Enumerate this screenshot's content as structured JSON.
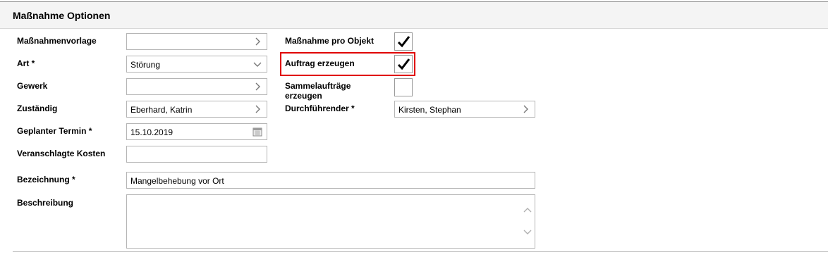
{
  "section": {
    "title": "Maßnahme Optionen"
  },
  "left_fields": {
    "vorlage": {
      "label": "Maßnahmenvorlage",
      "value": "",
      "icon": "chevron-right-icon"
    },
    "art": {
      "label": "Art *",
      "value": "Störung",
      "icon": "chevron-down-icon"
    },
    "gewerk": {
      "label": "Gewerk",
      "value": "",
      "icon": "chevron-right-icon"
    },
    "zustaendig": {
      "label": "Zuständig",
      "value": "Eberhard, Katrin",
      "icon": "chevron-right-icon"
    },
    "termin": {
      "label": "Geplanter Termin *",
      "value": "15.10.2019",
      "icon": "calendar-icon"
    },
    "kosten": {
      "label": "Veranschlagte Kosten",
      "value": ""
    },
    "bezeichnung": {
      "label": "Bezeichnung *",
      "value": "Mangelbehebung vor Ort"
    },
    "beschreibung": {
      "label": "Beschreibung",
      "value": ""
    }
  },
  "right_fields": {
    "pro_objekt": {
      "label": "Maßnahme pro Objekt",
      "checked": true
    },
    "auftrag": {
      "label": "Auftrag erzeugen",
      "checked": true,
      "highlight_color": "#e00000"
    },
    "sammel": {
      "label_line1": "Sammelaufträge",
      "label_line2": "erzeugen",
      "checked": false
    },
    "durchfuehrender": {
      "label": "Durchführender *",
      "value": "Kirsten, Stephan",
      "icon": "chevron-right-icon"
    }
  }
}
